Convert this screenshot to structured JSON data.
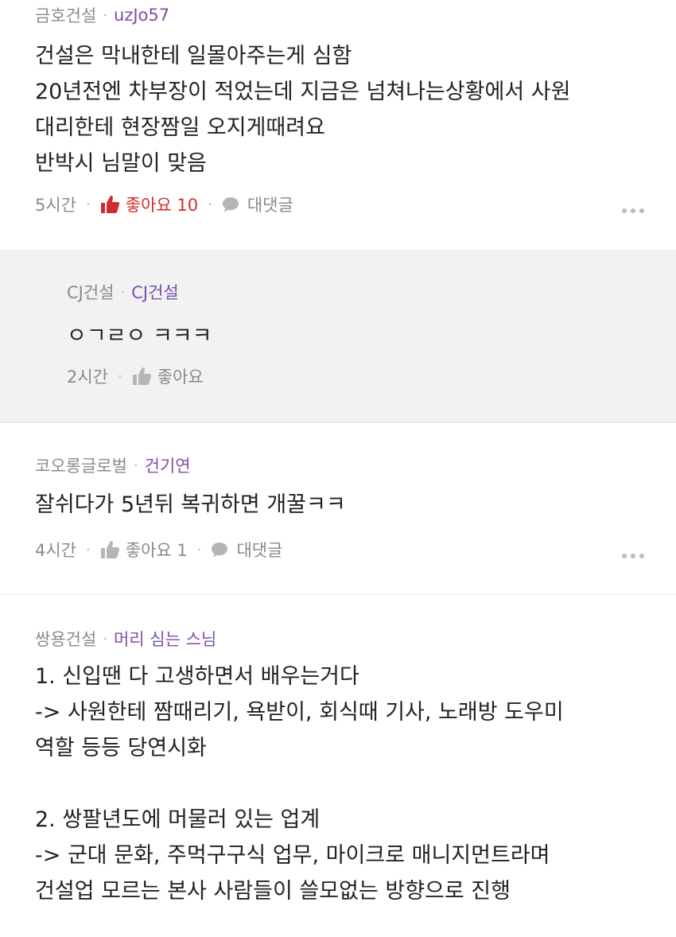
{
  "comments": [
    {
      "company": "금호건설",
      "nickname": "uzJo57",
      "lines": [
        "건설은 막내한테 일몰아주는게 심함",
        "20년전엔 차부장이 적었는데 지금은 넘쳐나는상황에서 사원",
        "대리한테 현장짬일 오지게때려요",
        "반박시 님말이 맞음"
      ],
      "time": "5시간",
      "like_label": "좋아요 10",
      "reply_label": "대댓글"
    },
    {
      "company": "CJ건설",
      "nickname": "CJ건설",
      "lines": [
        "ㅇㄱㄹㅇ ㅋㅋㅋ"
      ],
      "time": "2시간",
      "like_label": "좋아요"
    },
    {
      "company": "코오롱글로벌",
      "nickname": "건기연",
      "lines": [
        "잘쉬다가 5년뒤 복귀하면 개꿀ㅋㅋ"
      ],
      "time": "4시간",
      "like_label": "좋아요 1",
      "reply_label": "대댓글"
    },
    {
      "company": "쌍용건설",
      "nickname": "머리 심는 스님",
      "lines": [
        "1. 신입땐 다 고생하면서 배우는거다",
        "-> 사원한테 짬때리기, 욕받이, 회식때 기사, 노래방 도우미",
        "역할 등등 당연시화",
        "",
        "2. 쌍팔년도에 머물러 있는 업계",
        "-> 군대 문화, 주먹구구식 업무, 마이크로 매니지먼트라며",
        "건설업 모르는 본사 사람들이 쓸모없는 방향으로 진행"
      ]
    }
  ],
  "separator": "·",
  "colors": {
    "nickname": "#7b4fa8",
    "liked": "#d22d2d",
    "meta": "#8a8a8a",
    "reply_bg": "#f2f2f2"
  },
  "icons": {
    "like": "thumbs-up-icon",
    "reply": "speech-bubble-icon",
    "more": "more-dots-icon"
  }
}
